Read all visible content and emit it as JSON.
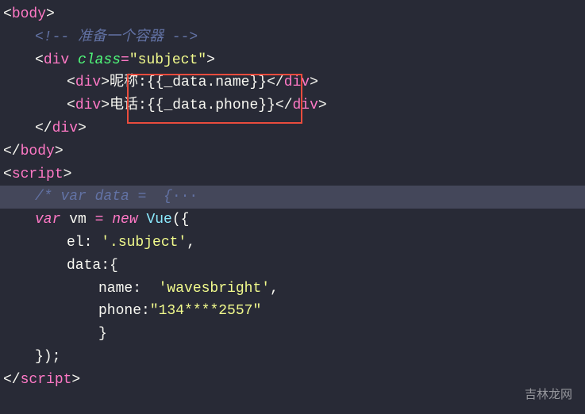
{
  "code": {
    "bodyOpen": "body",
    "commentPrep": "<!-- 准备一个容器 -->",
    "divTag": "div",
    "classAttr": "class",
    "subjectValue": "\"subject\"",
    "nickLabel": "昵称:",
    "nickExpr": "{{_data.name}}",
    "phoneLabel": "电话:",
    "phoneExpr": "{{_data.phone}}",
    "bodyClose": "body",
    "scriptTag": "script",
    "collapsedComment": "/* var data =  {",
    "collapsedDots": "···",
    "varKw": "var",
    "vmName": " vm ",
    "eqOp": "=",
    "newKw": " new ",
    "vueClass": "Vue",
    "openParen": "({",
    "elKey": "el",
    "elVal": "'.subject'",
    "dataKey": "data",
    "nameKey": "name",
    "nameVal": "'wavesbright'",
    "phoneKey": "phone",
    "phoneVal": "\"134****2557\"",
    "closeBrace": "}",
    "closeAll": "});"
  },
  "watermark": "吉林龙网"
}
